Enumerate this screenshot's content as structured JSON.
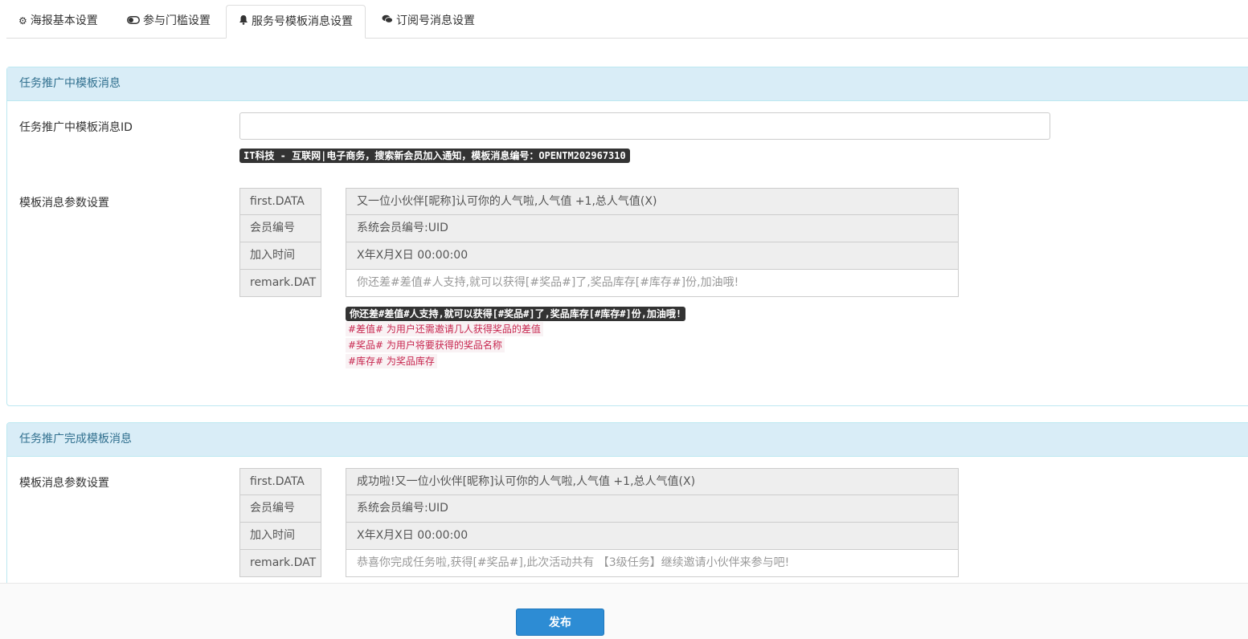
{
  "tabs": [
    {
      "label": "海报基本设置",
      "icon": "gear-icon"
    },
    {
      "label": "参与门槛设置",
      "icon": "toggle-icon"
    },
    {
      "label": "服务号模板消息设置",
      "icon": "bell-icon",
      "active": true
    },
    {
      "label": "订阅号消息设置",
      "icon": "comments-icon"
    }
  ],
  "panel1": {
    "heading": "任务推广中模板消息",
    "template_id_label": "任务推广中模板消息ID",
    "template_id_value": "",
    "template_hint": "IT科技 - 互联网|电子商务，搜索新会员加入通知，模板消息编号：OPENTM202967310",
    "params_label": "模板消息参数设置",
    "params": [
      {
        "key": "first.DATA",
        "value": "又一位小伙伴[昵称]认可你的人气啦,人气值 +1,总人气值(X)"
      },
      {
        "key": "会员编号",
        "value": "系统会员编号:UID"
      },
      {
        "key": "加入时间",
        "value": "X年X月X日 00:00:00"
      },
      {
        "key": "remark.DAT",
        "value": "你还差#差值#人支持,就可以获得[#奖品#]了,奖品库存[#库存#]份,加油哦!"
      }
    ],
    "remark_preview": "你还差#差值#人支持,就可以获得[#奖品#]了,奖品库存[#库存#]份,加油哦!",
    "hints": [
      "#差值# 为用户还需邀请几人获得奖品的差值",
      "#奖品# 为用户将要获得的奖品名称",
      "#库存# 为奖品库存"
    ]
  },
  "panel2": {
    "heading": "任务推广完成模板消息",
    "params_label": "模板消息参数设置",
    "params": [
      {
        "key": "first.DATA",
        "value": "成功啦!又一位小伙伴[昵称]认可你的人气啦,人气值 +1,总人气值(X)"
      },
      {
        "key": "会员编号",
        "value": "系统会员编号:UID"
      },
      {
        "key": "加入时间",
        "value": "X年X月X日 00:00:00"
      },
      {
        "key": "remark.DAT",
        "value": "恭喜你完成任务啦,获得[#奖品#],此次活动共有 【3级任务】继续邀请小伙伴来参与吧!"
      }
    ]
  },
  "footer": {
    "publish_label": "发布"
  },
  "colors": {
    "panel_heading_bg": "#d9edf7",
    "panel_heading_text": "#31708f",
    "panel_border": "#bce8f1",
    "primary_button": "#2d8cd4",
    "hint_text": "#c7254e",
    "badge_bg": "#333333"
  }
}
